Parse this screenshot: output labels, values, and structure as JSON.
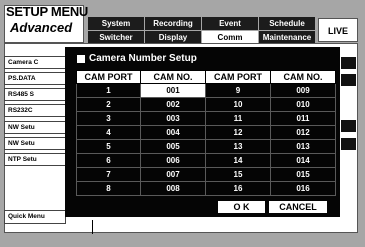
{
  "header": {
    "title_line1": "SETUP MENU",
    "title_line2": "Advanced",
    "tabs_top": [
      "System",
      "Recording",
      "Event",
      "Schedule"
    ],
    "tabs_bottom": [
      "Switcher",
      "Display",
      "Comm",
      "Maintenance"
    ],
    "active_tab": "Comm",
    "live_label": "LIVE"
  },
  "sidebar": {
    "items": [
      "Camera C",
      "PS.DATA",
      "RS485 S",
      "RS232C",
      "NW Setu",
      "NW Setu",
      "NTP Setu"
    ],
    "quick_menu_label": "Quick Menu"
  },
  "dialog": {
    "title": "Camera Number Setup",
    "headers": [
      "CAM PORT",
      "CAM NO.",
      "CAM PORT",
      "CAM NO."
    ],
    "rows": [
      [
        "1",
        "001",
        "9",
        "009"
      ],
      [
        "2",
        "002",
        "10",
        "010"
      ],
      [
        "3",
        "003",
        "11",
        "011"
      ],
      [
        "4",
        "004",
        "12",
        "012"
      ],
      [
        "5",
        "005",
        "13",
        "013"
      ],
      [
        "6",
        "006",
        "14",
        "014"
      ],
      [
        "7",
        "007",
        "15",
        "015"
      ],
      [
        "8",
        "008",
        "16",
        "016"
      ]
    ],
    "selected_cell": "001",
    "ok_label": "O K",
    "cancel_label": "CANCEL"
  },
  "colors": {
    "background": "#a6a6a6",
    "dialog_bg": "#050505",
    "selected": "#ffffff"
  }
}
